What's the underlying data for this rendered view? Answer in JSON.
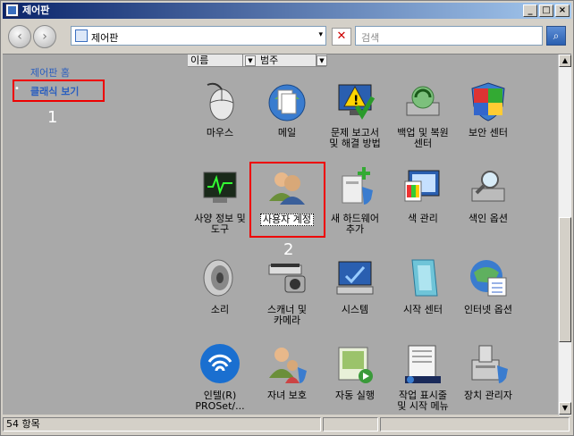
{
  "window": {
    "title": "제어판"
  },
  "titlebar_buttons": {
    "minimize": "_",
    "maximize": "□",
    "close": "×"
  },
  "address": {
    "path": "제어판",
    "dropdown": "▾"
  },
  "search": {
    "placeholder": "검색"
  },
  "sidebar": {
    "home": "제어판 홈",
    "classic": "클래식 보기",
    "bullet": "•"
  },
  "columns": {
    "name": "이름",
    "category": "범주"
  },
  "annotations": {
    "n1": "1",
    "n2": "2"
  },
  "items": [
    {
      "label": "마우스",
      "icon": "mouse-icon"
    },
    {
      "label": "메일",
      "icon": "mail-icon"
    },
    {
      "label": "문제 보고서\n및 해결 방법",
      "icon": "problem-report-icon"
    },
    {
      "label": "백업 및 복원\n센터",
      "icon": "backup-icon"
    },
    {
      "label": "보안 센터",
      "icon": "security-shield-icon"
    },
    {
      "label": "사양 정보 및\n도구",
      "icon": "performance-icon"
    },
    {
      "label": "사용자 계정",
      "icon": "user-accounts-icon"
    },
    {
      "label": "새 하드웨어\n추가",
      "icon": "add-hardware-icon"
    },
    {
      "label": "색 관리",
      "icon": "color-management-icon"
    },
    {
      "label": "색인 옵션",
      "icon": "indexing-icon"
    },
    {
      "label": "소리",
      "icon": "speaker-icon"
    },
    {
      "label": "스캐너 및\n카메라",
      "icon": "scanner-icon"
    },
    {
      "label": "시스템",
      "icon": "system-icon"
    },
    {
      "label": "시작 센터",
      "icon": "welcome-center-icon"
    },
    {
      "label": "인터넷 옵션",
      "icon": "internet-options-icon"
    },
    {
      "label": "인텔(R)\nPROSet/...",
      "icon": "intel-wireless-icon"
    },
    {
      "label": "자녀 보호",
      "icon": "parental-controls-icon"
    },
    {
      "label": "자동 실행",
      "icon": "autoplay-icon"
    },
    {
      "label": "작업 표시줄\n및 시작 메뉴",
      "icon": "taskbar-icon"
    },
    {
      "label": "장치 관리자",
      "icon": "device-manager-icon"
    }
  ],
  "status": {
    "count": "54 항목"
  }
}
